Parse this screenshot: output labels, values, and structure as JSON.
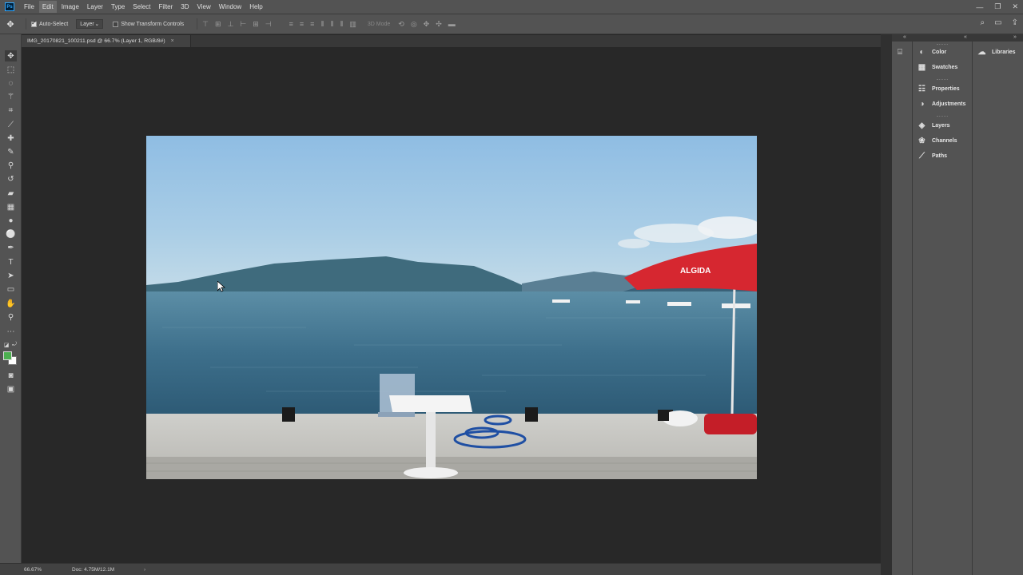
{
  "app": {
    "logo": "Ps",
    "theme_colors": {
      "panel": "#535353",
      "canvas_bg": "#282828",
      "accent": "#31a8ff"
    }
  },
  "menu": [
    "File",
    "Edit",
    "Image",
    "Layer",
    "Type",
    "Select",
    "Filter",
    "3D",
    "View",
    "Window",
    "Help"
  ],
  "menu_active": "Edit",
  "window_controls": [
    "minimize-icon",
    "restore-icon",
    "close-icon"
  ],
  "options": {
    "tool_icon": "move-tool-icon",
    "auto_select_label": "Auto-Select",
    "auto_select_checked": true,
    "auto_select_target": "Layer",
    "transform_label": "Show Transform Controls",
    "transform_checked": false,
    "mode_3d_label": "3D Mode",
    "right_icons": [
      "search-icon",
      "workspace-icon",
      "share-icon"
    ]
  },
  "document": {
    "tab_title": "IMG_20170821_100211.psd @ 66.7% (Layer 1, RGB/8#)",
    "close_glyph": "×"
  },
  "status": {
    "zoom": "66.67%",
    "doc_size": "Doc: 4.75M/12.1M",
    "arrow": "›"
  },
  "panels": {
    "dock1": [
      {
        "label": "Color",
        "icon": "color-wheel-icon"
      },
      {
        "label": "Swatches",
        "icon": "swatches-grid-icon"
      },
      {
        "label": "Properties",
        "icon": "properties-icon"
      },
      {
        "label": "Adjustments",
        "icon": "adjustments-icon"
      },
      {
        "label": "Layers",
        "icon": "layers-icon"
      },
      {
        "label": "Channels",
        "icon": "channels-icon"
      },
      {
        "label": "Paths",
        "icon": "paths-icon"
      }
    ],
    "dock2": [
      {
        "label": "Libraries",
        "icon": "libraries-cloud-icon"
      }
    ]
  },
  "tools": [
    "move",
    "marquee",
    "lasso",
    "magic-wand",
    "crop",
    "eyedropper",
    "healing-brush",
    "brush",
    "clone-stamp",
    "history-brush",
    "eraser",
    "gradient",
    "blur",
    "dodge",
    "pen",
    "type",
    "path-selection",
    "rectangle",
    "hand",
    "zoom",
    "more"
  ],
  "colors": {
    "foreground": "#4caf50",
    "background": "#ffffff"
  },
  "photo": {
    "umbrella_text": "ALGIDA"
  }
}
